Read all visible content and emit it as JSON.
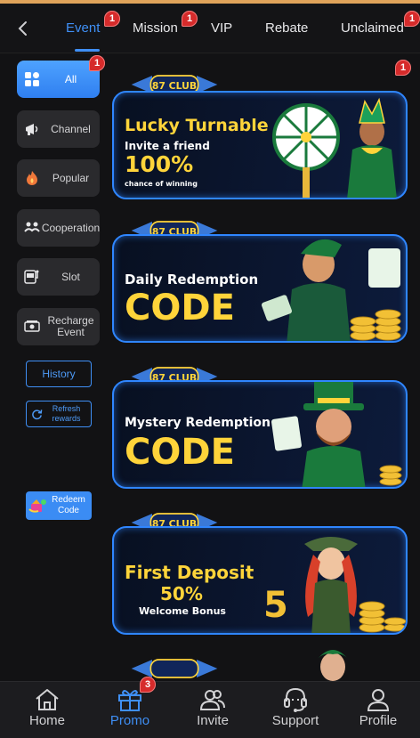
{
  "tabs": [
    {
      "label": "Event",
      "active": true,
      "badge": "1"
    },
    {
      "label": "Mission",
      "active": false,
      "badge": "1"
    },
    {
      "label": "VIP",
      "active": false,
      "badge": ""
    },
    {
      "label": "Rebate",
      "active": false,
      "badge": ""
    },
    {
      "label": "Unclaimed",
      "active": false,
      "badge": "1"
    }
  ],
  "sidebar": {
    "items": [
      {
        "label": "All",
        "icon": "grid-icon",
        "active": true,
        "badge": "1"
      },
      {
        "label": "Channel",
        "icon": "megaphone-icon"
      },
      {
        "label": "Popular",
        "icon": "flame-icon"
      },
      {
        "label": "Cooperation",
        "icon": "handshake-icon"
      },
      {
        "label": "Slot",
        "icon": "slot-machine-icon"
      },
      {
        "label": "Recharge Event",
        "icon": "cash-icon"
      }
    ],
    "history": "History",
    "refresh": "Refresh rewards",
    "redeem": "Redeem Code"
  },
  "content_badge": "1",
  "banners": [
    {
      "logo": "87 CLUB",
      "line1": "Lucky Turnable",
      "line2": "Invite a friend",
      "line3": "100%",
      "line4": "chance of winning"
    },
    {
      "logo": "87 CLUB",
      "line1": "Daily Redemption",
      "line2": "CODE"
    },
    {
      "logo": "87 CLUB",
      "line1": "Mystery Redemption",
      "line2": "CODE"
    },
    {
      "logo": "87 CLUB",
      "line1": "First Deposit",
      "line2": "50%",
      "line3": "Welcome Bonus"
    }
  ],
  "bottom_nav": [
    {
      "label": "Home",
      "icon": "home-icon",
      "active": false
    },
    {
      "label": "Promo",
      "icon": "gift-icon",
      "active": true,
      "badge": "3"
    },
    {
      "label": "Invite",
      "icon": "people-icon",
      "active": false
    },
    {
      "label": "Support",
      "icon": "headset-icon",
      "active": false
    },
    {
      "label": "Profile",
      "icon": "person-icon",
      "active": false
    }
  ],
  "colors": {
    "accent": "#3f8ff5",
    "badge": "#d62b2b",
    "banner_border": "#2f86ff",
    "banner_yellow": "#ffd43a"
  }
}
